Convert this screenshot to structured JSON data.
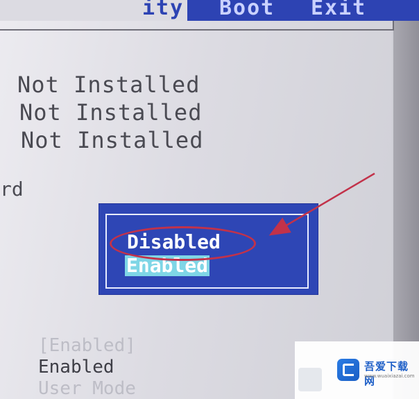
{
  "menu": {
    "partial_label": "ity",
    "boot_label": "Boot",
    "exit_label": "Exit"
  },
  "status_values": [
    "Not Installed",
    "Not Installed",
    "Not Installed"
  ],
  "side_fragment": "rd",
  "dialog": {
    "options": [
      "Disabled",
      "Enabled"
    ],
    "selected": "Enabled"
  },
  "lower_values": [
    "[Enabled]",
    "Enabled",
    "User Mode"
  ],
  "watermark": {
    "title": "吾爱下载网",
    "url": "www.wuaixiazai.com"
  },
  "colors": {
    "bios_blue": "#2e46b5",
    "highlight": "#7fd6e6",
    "annotation_red": "#c2324a"
  },
  "icons": {
    "annotation_arrow": "arrow-icon",
    "watermark_logo": "logo-icon"
  }
}
